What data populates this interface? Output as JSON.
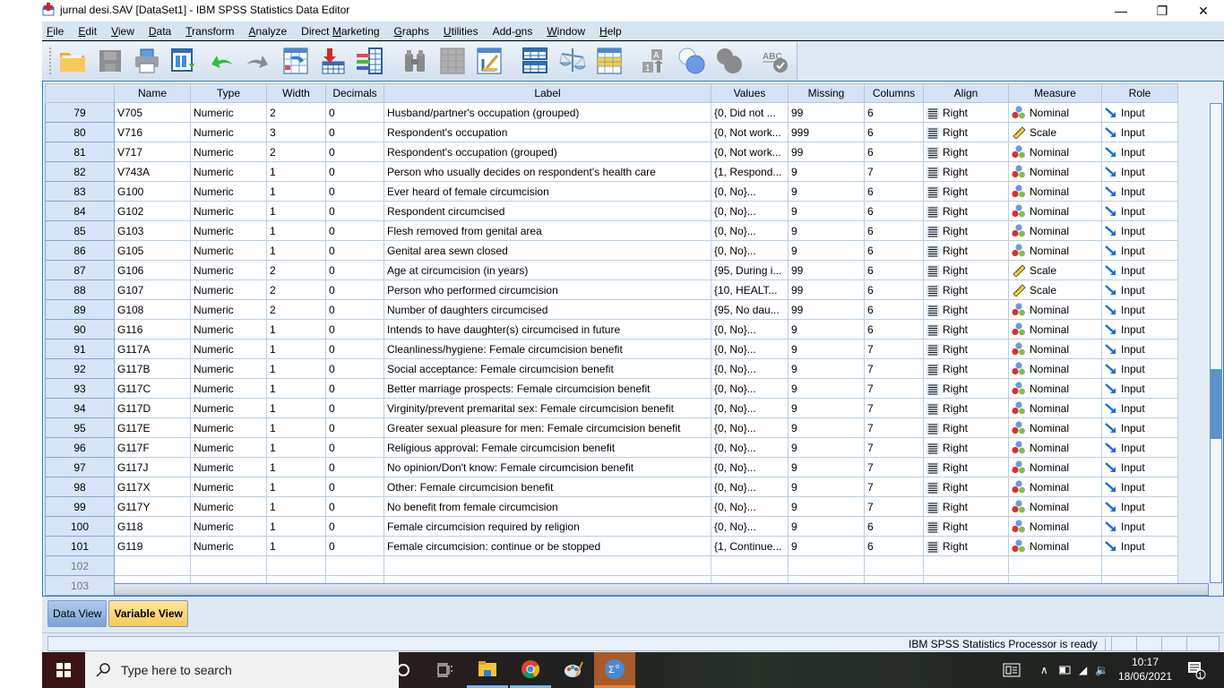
{
  "window": {
    "title": "jurnal desi.SAV [DataSet1] - IBM SPSS Statistics Data Editor",
    "controls": {
      "minimize": "—",
      "restore": "❐",
      "close": "✕"
    }
  },
  "menu": [
    {
      "label": "File",
      "ul": "F",
      "rest": "ile"
    },
    {
      "label": "Edit",
      "ul": "E",
      "rest": "dit"
    },
    {
      "label": "View",
      "ul": "V",
      "rest": "iew"
    },
    {
      "label": "Data",
      "ul": "D",
      "rest": "ata"
    },
    {
      "label": "Transform",
      "ul": "T",
      "rest": "ransform"
    },
    {
      "label": "Analyze",
      "ul": "A",
      "rest": "nalyze"
    },
    {
      "label": "Direct Marketing",
      "pre": "Direct ",
      "ul": "M",
      "rest": "arketing"
    },
    {
      "label": "Graphs",
      "ul": "G",
      "rest": "raphs"
    },
    {
      "label": "Utilities",
      "ul": "U",
      "rest": "tilities"
    },
    {
      "label": "Add-ons",
      "pre": "Add-",
      "ul": "o",
      "rest": "ns"
    },
    {
      "label": "Window",
      "ul": "W",
      "rest": "indow"
    },
    {
      "label": "Help",
      "ul": "H",
      "rest": "elp"
    }
  ],
  "toolbar": [
    {
      "name": "open-data-document",
      "icon": "folder-icon"
    },
    {
      "name": "save-document",
      "icon": "save-icon",
      "disabled": true
    },
    {
      "name": "print",
      "icon": "printer-icon"
    },
    {
      "name": "recall-dialog",
      "icon": "recall-dialog-icon"
    },
    {
      "name": "undo",
      "icon": "undo-icon"
    },
    {
      "name": "redo",
      "icon": "redo-icon",
      "disabled": true
    },
    {
      "name": "go-to-case",
      "icon": "go-to-case-icon"
    },
    {
      "name": "go-to-variable",
      "icon": "go-to-variable-icon"
    },
    {
      "name": "variables",
      "icon": "variables-icon"
    },
    {
      "name": "find",
      "icon": "binoculars-icon",
      "disabled": true
    },
    {
      "name": "insert-cases",
      "icon": "insert-cases-icon",
      "disabled": true
    },
    {
      "name": "insert-variable",
      "icon": "insert-variable-icon"
    },
    {
      "name": "split-file",
      "icon": "split-file-icon"
    },
    {
      "name": "weight-cases",
      "icon": "scales-icon"
    },
    {
      "name": "select-cases",
      "icon": "select-cases-icon"
    },
    {
      "name": "value-labels",
      "icon": "value-labels-icon"
    },
    {
      "name": "use-variable-sets",
      "icon": "variable-sets-icon"
    },
    {
      "name": "show-all-variables",
      "icon": "show-all-variables-icon",
      "disabled": true
    },
    {
      "name": "spell-check",
      "icon": "spell-check-icon",
      "disabled": true
    }
  ],
  "grid": {
    "headers": [
      "Name",
      "Type",
      "Width",
      "Decimals",
      "Label",
      "Values",
      "Missing",
      "Columns",
      "Align",
      "Measure",
      "Role"
    ],
    "rows": [
      {
        "n": "79",
        "name": "V705",
        "type": "Numeric",
        "width": "2",
        "dec": "0",
        "label": "Husband/partner's occupation (grouped)",
        "values": "{0, Did not ...",
        "missing": "99",
        "columns": "6",
        "align": "Right",
        "measure": "Nominal",
        "role": "Input"
      },
      {
        "n": "80",
        "name": "V716",
        "type": "Numeric",
        "width": "3",
        "dec": "0",
        "label": "Respondent's occupation",
        "values": "{0, Not work...",
        "missing": "999",
        "columns": "6",
        "align": "Right",
        "measure": "Scale",
        "role": "Input"
      },
      {
        "n": "81",
        "name": "V717",
        "type": "Numeric",
        "width": "2",
        "dec": "0",
        "label": "Respondent's occupation (grouped)",
        "values": "{0, Not work...",
        "missing": "99",
        "columns": "6",
        "align": "Right",
        "measure": "Nominal",
        "role": "Input"
      },
      {
        "n": "82",
        "name": "V743A",
        "type": "Numeric",
        "width": "1",
        "dec": "0",
        "label": "Person who usually decides on respondent's health care",
        "values": "{1, Respond...",
        "missing": "9",
        "columns": "7",
        "align": "Right",
        "measure": "Nominal",
        "role": "Input"
      },
      {
        "n": "83",
        "name": "G100",
        "type": "Numeric",
        "width": "1",
        "dec": "0",
        "label": "Ever heard of female circumcision",
        "values": "{0, No}...",
        "missing": "9",
        "columns": "6",
        "align": "Right",
        "measure": "Nominal",
        "role": "Input"
      },
      {
        "n": "84",
        "name": "G102",
        "type": "Numeric",
        "width": "1",
        "dec": "0",
        "label": "Respondent circumcised",
        "values": "{0, No}...",
        "missing": "9",
        "columns": "6",
        "align": "Right",
        "measure": "Nominal",
        "role": "Input"
      },
      {
        "n": "85",
        "name": "G103",
        "type": "Numeric",
        "width": "1",
        "dec": "0",
        "label": "Flesh removed from genital area",
        "values": "{0, No}...",
        "missing": "9",
        "columns": "6",
        "align": "Right",
        "measure": "Nominal",
        "role": "Input"
      },
      {
        "n": "86",
        "name": "G105",
        "type": "Numeric",
        "width": "1",
        "dec": "0",
        "label": "Genital area sewn closed",
        "values": "{0, No}...",
        "missing": "9",
        "columns": "6",
        "align": "Right",
        "measure": "Nominal",
        "role": "Input"
      },
      {
        "n": "87",
        "name": "G106",
        "type": "Numeric",
        "width": "2",
        "dec": "0",
        "label": "Age at circumcision (in years)",
        "values": "{95, During i...",
        "missing": "99",
        "columns": "6",
        "align": "Right",
        "measure": "Scale",
        "role": "Input"
      },
      {
        "n": "88",
        "name": "G107",
        "type": "Numeric",
        "width": "2",
        "dec": "0",
        "label": "Person who performed circumcision",
        "values": "{10, HEALT...",
        "missing": "99",
        "columns": "6",
        "align": "Right",
        "measure": "Scale",
        "role": "Input"
      },
      {
        "n": "89",
        "name": "G108",
        "type": "Numeric",
        "width": "2",
        "dec": "0",
        "label": "Number of daughters circumcised",
        "values": "{95, No dau...",
        "missing": "99",
        "columns": "6",
        "align": "Right",
        "measure": "Nominal",
        "role": "Input"
      },
      {
        "n": "90",
        "name": "G116",
        "type": "Numeric",
        "width": "1",
        "dec": "0",
        "label": "Intends to have daughter(s) circumcised in future",
        "values": "{0, No}...",
        "missing": "9",
        "columns": "6",
        "align": "Right",
        "measure": "Nominal",
        "role": "Input"
      },
      {
        "n": "91",
        "name": "G117A",
        "type": "Numeric",
        "width": "1",
        "dec": "0",
        "label": "Cleanliness/hygiene: Female circumcision benefit",
        "values": "{0, No}...",
        "missing": "9",
        "columns": "7",
        "align": "Right",
        "measure": "Nominal",
        "role": "Input"
      },
      {
        "n": "92",
        "name": "G117B",
        "type": "Numeric",
        "width": "1",
        "dec": "0",
        "label": "Social acceptance: Female circumcision benefit",
        "values": "{0, No}...",
        "missing": "9",
        "columns": "7",
        "align": "Right",
        "measure": "Nominal",
        "role": "Input"
      },
      {
        "n": "93",
        "name": "G117C",
        "type": "Numeric",
        "width": "1",
        "dec": "0",
        "label": "Better marriage prospects: Female circumcision benefit",
        "values": "{0, No}...",
        "missing": "9",
        "columns": "7",
        "align": "Right",
        "measure": "Nominal",
        "role": "Input"
      },
      {
        "n": "94",
        "name": "G117D",
        "type": "Numeric",
        "width": "1",
        "dec": "0",
        "label": "Virginity/prevent premarital sex: Female circumcision benefit",
        "values": "{0, No}...",
        "missing": "9",
        "columns": "7",
        "align": "Right",
        "measure": "Nominal",
        "role": "Input"
      },
      {
        "n": "95",
        "name": "G117E",
        "type": "Numeric",
        "width": "1",
        "dec": "0",
        "label": "Greater sexual pleasure for men: Female circumcision benefit",
        "values": "{0, No}...",
        "missing": "9",
        "columns": "7",
        "align": "Right",
        "measure": "Nominal",
        "role": "Input"
      },
      {
        "n": "96",
        "name": "G117F",
        "type": "Numeric",
        "width": "1",
        "dec": "0",
        "label": "Religious approval: Female circumcision benefit",
        "values": "{0, No}...",
        "missing": "9",
        "columns": "7",
        "align": "Right",
        "measure": "Nominal",
        "role": "Input"
      },
      {
        "n": "97",
        "name": "G117J",
        "type": "Numeric",
        "width": "1",
        "dec": "0",
        "label": "No opinion/Don't know: Female circumcision benefit",
        "values": "{0, No}...",
        "missing": "9",
        "columns": "7",
        "align": "Right",
        "measure": "Nominal",
        "role": "Input"
      },
      {
        "n": "98",
        "name": "G117X",
        "type": "Numeric",
        "width": "1",
        "dec": "0",
        "label": "Other: Female circumcision benefit",
        "values": "{0, No}...",
        "missing": "9",
        "columns": "7",
        "align": "Right",
        "measure": "Nominal",
        "role": "Input"
      },
      {
        "n": "99",
        "name": "G117Y",
        "type": "Numeric",
        "width": "1",
        "dec": "0",
        "label": "No benefit from female circumcision",
        "values": "{0, No}...",
        "missing": "9",
        "columns": "7",
        "align": "Right",
        "measure": "Nominal",
        "role": "Input"
      },
      {
        "n": "100",
        "name": "G118",
        "type": "Numeric",
        "width": "1",
        "dec": "0",
        "label": "Female circumcision required by religion",
        "values": "{0, No}...",
        "missing": "9",
        "columns": "6",
        "align": "Right",
        "measure": "Nominal",
        "role": "Input"
      },
      {
        "n": "101",
        "name": "G119",
        "type": "Numeric",
        "width": "1",
        "dec": "0",
        "label": "Female circumcision: continue or be stopped",
        "values": "{1, Continue...",
        "missing": "9",
        "columns": "6",
        "align": "Right",
        "measure": "Nominal",
        "role": "Input"
      }
    ],
    "empty_rows": [
      "102",
      "103"
    ]
  },
  "tabs": {
    "data_view": "Data View",
    "variable_view": "Variable View",
    "active": "Variable View"
  },
  "status": {
    "text": "IBM SPSS Statistics Processor is ready"
  },
  "taskbar": {
    "search_placeholder": "Type here to search",
    "time": "10:17",
    "date": "18/06/2021",
    "notification_count": "1"
  }
}
